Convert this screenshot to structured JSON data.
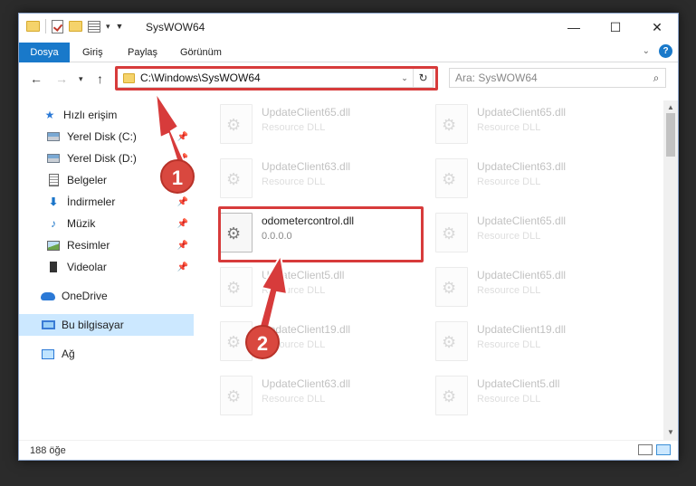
{
  "window": {
    "title": "SysWOW64"
  },
  "ribbon": {
    "tabs": [
      "Dosya",
      "Giriş",
      "Paylaş",
      "Görünüm"
    ],
    "help": "?"
  },
  "nav": {
    "address": "C:\\Windows\\SysWOW64",
    "search_placeholder": "Ara: SysWOW64"
  },
  "sidebar": {
    "items": [
      {
        "label": "Hızlı erişim",
        "icon": "star-icon"
      },
      {
        "label": "Yerel Disk (C:)",
        "icon": "drive-icon"
      },
      {
        "label": "Yerel Disk (D:)",
        "icon": "drive-icon"
      },
      {
        "label": "Belgeler",
        "icon": "documents-icon"
      },
      {
        "label": "İndirmeler",
        "icon": "downloads-icon"
      },
      {
        "label": "Müzik",
        "icon": "music-icon"
      },
      {
        "label": "Resimler",
        "icon": "pictures-icon"
      },
      {
        "label": "Videolar",
        "icon": "videos-icon"
      },
      {
        "label": "OneDrive",
        "icon": "onedrive-icon"
      },
      {
        "label": "Bu bilgisayar",
        "icon": "this-pc-icon"
      },
      {
        "label": "Ağ",
        "icon": "network-icon"
      }
    ]
  },
  "files": [
    {
      "name": "UpdateClient65.dll",
      "sub": "Resource DLL"
    },
    {
      "name": "UpdateClient65.dll",
      "sub": "Resource DLL"
    },
    {
      "name": "UpdateClient63.dll",
      "sub": "Resource DLL"
    },
    {
      "name": "UpdateClient63.dll",
      "sub": "Resource DLL"
    },
    {
      "name": "odometercontrol.dll",
      "sub": "0.0.0.0"
    },
    {
      "name": "UpdateClient65.dll",
      "sub": "Resource DLL"
    },
    {
      "name": "UpdateClient5.dll",
      "sub": "Resource DLL"
    },
    {
      "name": "UpdateClient65.dll",
      "sub": "Resource DLL"
    },
    {
      "name": "UpdateClient19.dll",
      "sub": "Resource DLL"
    },
    {
      "name": "UpdateClient19.dll",
      "sub": "Resource DLL"
    },
    {
      "name": "UpdateClient63.dll",
      "sub": "Resource DLL"
    },
    {
      "name": "UpdateClient5.dll",
      "sub": "Resource DLL"
    }
  ],
  "status": {
    "count": "188 öğe"
  },
  "annotations": {
    "step1": "1",
    "step2": "2",
    "color": "#d73b3b"
  }
}
